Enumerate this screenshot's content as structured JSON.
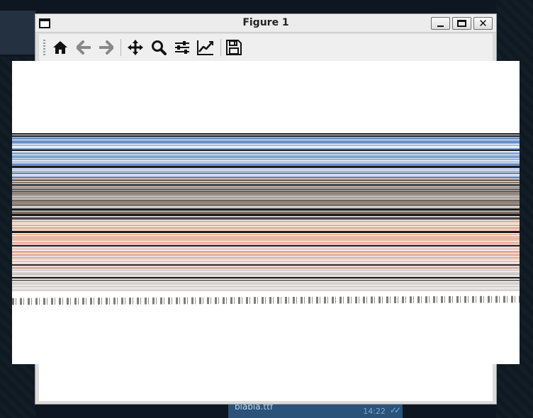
{
  "window": {
    "title": "Figure 1"
  },
  "toolbar": {
    "buttons": [
      {
        "name": "home-icon"
      },
      {
        "name": "back-arrow-icon"
      },
      {
        "name": "forward-arrow-icon"
      },
      {
        "name": "pan-icon"
      },
      {
        "name": "zoom-icon"
      },
      {
        "name": "subplots-config-icon"
      },
      {
        "name": "axes-edit-icon"
      },
      {
        "name": "save-icon"
      }
    ]
  },
  "background_chat": {
    "file_name": "blabla.ttf",
    "time": "14:22"
  },
  "colors": {
    "stripe_blue": "#5b86c5",
    "stripe_brown": "#6a5d52",
    "stripe_salmon": "#d9967a",
    "stripe_gray": "#c9c3bf"
  }
}
